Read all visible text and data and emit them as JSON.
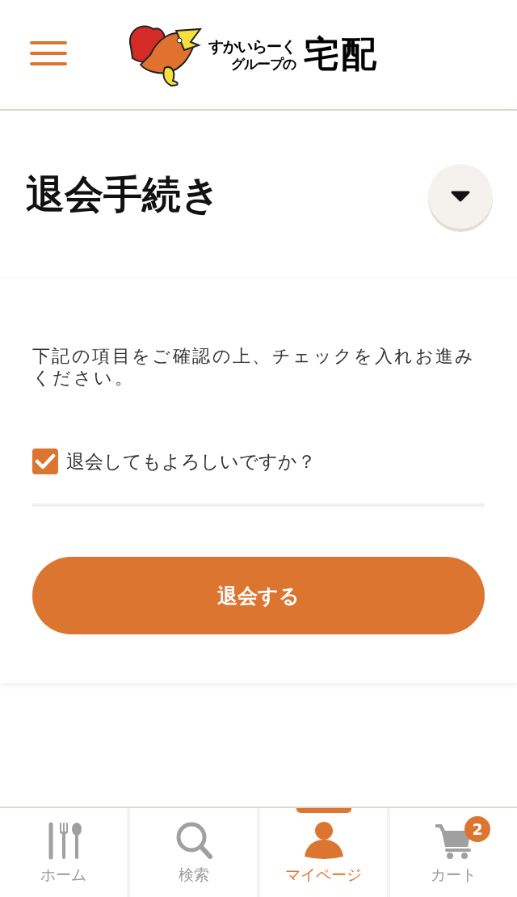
{
  "header": {
    "logo": {
      "line_1": "すかいらーく",
      "line_2": "グループの",
      "main": "宅配"
    }
  },
  "page": {
    "title": "退会手続き",
    "expanded": false
  },
  "form": {
    "instruction": "下記の項目をご確認の上、チェックを入れお進みください。",
    "confirm": {
      "label": "退会してもよろしいですか？",
      "checked": true
    },
    "submit": "退会する"
  },
  "bottom_nav": [
    {
      "kind": "cutlery",
      "label": "ホーム",
      "selected": false
    },
    {
      "kind": "search",
      "label": "検索",
      "selected": false
    },
    {
      "kind": "person",
      "label": "マイページ",
      "selected": true
    },
    {
      "kind": "cart",
      "label": "カート",
      "selected": false,
      "badge": "2"
    }
  ]
}
